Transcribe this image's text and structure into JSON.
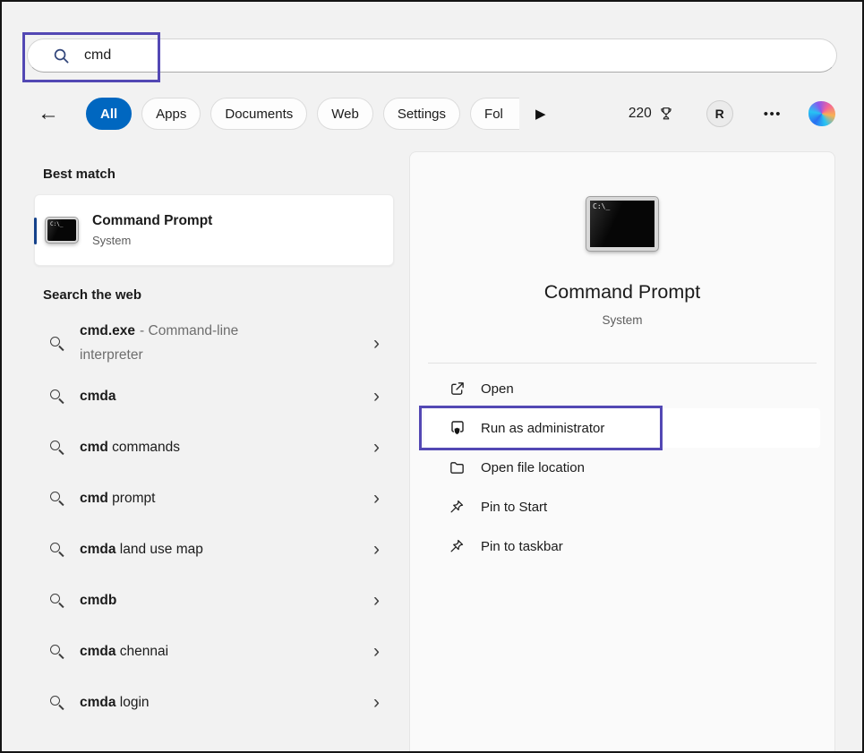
{
  "colors": {
    "accent_blue": "#0067c0",
    "annotation_purple": "#5348b4",
    "window_bg": "#f2f2f2"
  },
  "icons": {
    "back_arrow": "←",
    "play": "▶",
    "chevron_right": "›",
    "more_dots": "•••"
  },
  "search": {
    "value": "cmd"
  },
  "filters": {
    "tabs": [
      {
        "label": "All",
        "active": true
      },
      {
        "label": "Apps",
        "active": false
      },
      {
        "label": "Documents",
        "active": false
      },
      {
        "label": "Web",
        "active": false
      },
      {
        "label": "Settings",
        "active": false
      },
      {
        "label": "Fol",
        "active": false
      }
    ]
  },
  "topbar": {
    "rewards_points": "220",
    "avatar_initial": "R"
  },
  "terminal_icon_text": "C:\\_",
  "left_panel": {
    "best_match_heading": "Best match",
    "best_match": {
      "title": "Command Prompt",
      "subtitle": "System"
    },
    "web_heading": "Search the web",
    "suggestions": [
      {
        "bold": "cmd.exe",
        "rest": "",
        "desc": "- Command-line interpreter"
      },
      {
        "bold": "cmda",
        "rest": "",
        "desc": ""
      },
      {
        "bold": "cmd",
        "rest": " commands",
        "desc": ""
      },
      {
        "bold": "cmd",
        "rest": " prompt",
        "desc": ""
      },
      {
        "bold": "cmda",
        "rest": " land use map",
        "desc": ""
      },
      {
        "bold": "cmdb",
        "rest": "",
        "desc": ""
      },
      {
        "bold": "cmda",
        "rest": " chennai",
        "desc": ""
      },
      {
        "bold": "cmda",
        "rest": " login",
        "desc": ""
      }
    ]
  },
  "right_panel": {
    "app_title": "Command Prompt",
    "app_subtitle": "System",
    "actions": [
      {
        "label": "Open"
      },
      {
        "label": "Run as administrator"
      },
      {
        "label": "Open file location"
      },
      {
        "label": "Pin to Start"
      },
      {
        "label": "Pin to taskbar"
      }
    ]
  }
}
